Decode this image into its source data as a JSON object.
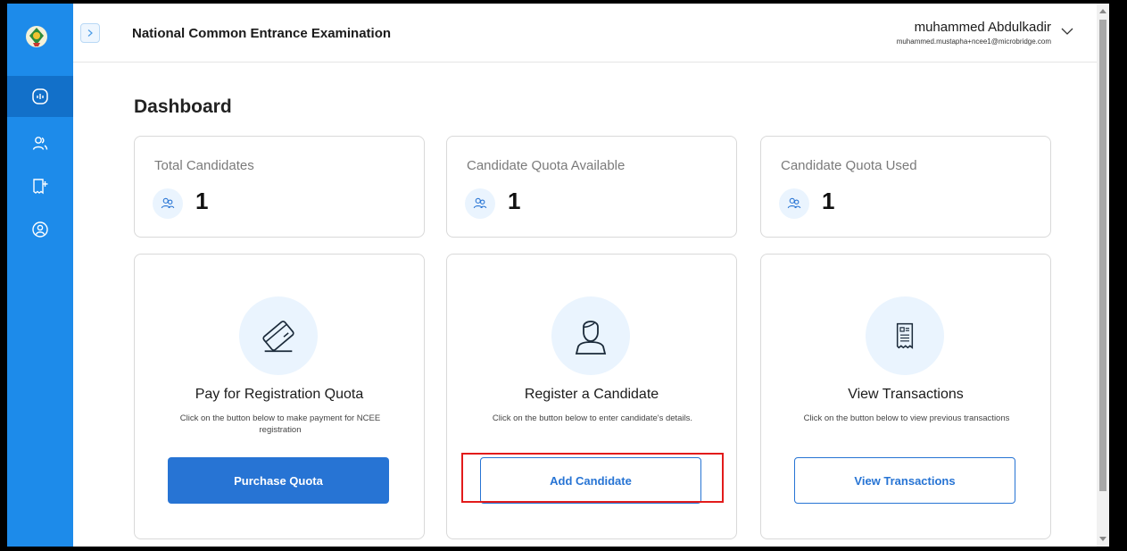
{
  "header": {
    "app_title": "National Common Entrance Examination",
    "user_name": "muhammed Abdulkadir",
    "user_email": "muhammed.mustapha+ncee1@microbridge.com"
  },
  "sidebar": {
    "items": [
      {
        "icon": "dashboard-icon",
        "active": true
      },
      {
        "icon": "users-icon",
        "active": false
      },
      {
        "icon": "receipt-add-icon",
        "active": false
      },
      {
        "icon": "profile-icon",
        "active": false
      }
    ]
  },
  "main": {
    "page_title": "Dashboard",
    "stats": [
      {
        "label": "Total Candidates",
        "value": "1",
        "icon": "users-icon"
      },
      {
        "label": "Candidate Quota Available",
        "value": "1",
        "icon": "users-icon"
      },
      {
        "label": "Candidate Quota Used",
        "value": "1",
        "icon": "users-icon"
      }
    ],
    "actions": [
      {
        "title": "Pay for Registration Quota",
        "description": "Click on the button below to make payment for NCEE registration",
        "button": "Purchase Quota",
        "icon": "card-icon"
      },
      {
        "title": "Register a Candidate",
        "description": "Click on the button below to enter candidate's details.",
        "button": "Add Candidate",
        "icon": "candidate-icon"
      },
      {
        "title": "View Transactions",
        "description": "Click on the button below to view previous transactions",
        "button": "View Transactions",
        "icon": "receipt-icon"
      }
    ]
  },
  "colors": {
    "sidebar": "#1d8bea",
    "sidebar_active": "#1270c9",
    "primary": "#2774d4",
    "icon_bg": "#eaf4fe",
    "highlight": "#e21b1b"
  }
}
